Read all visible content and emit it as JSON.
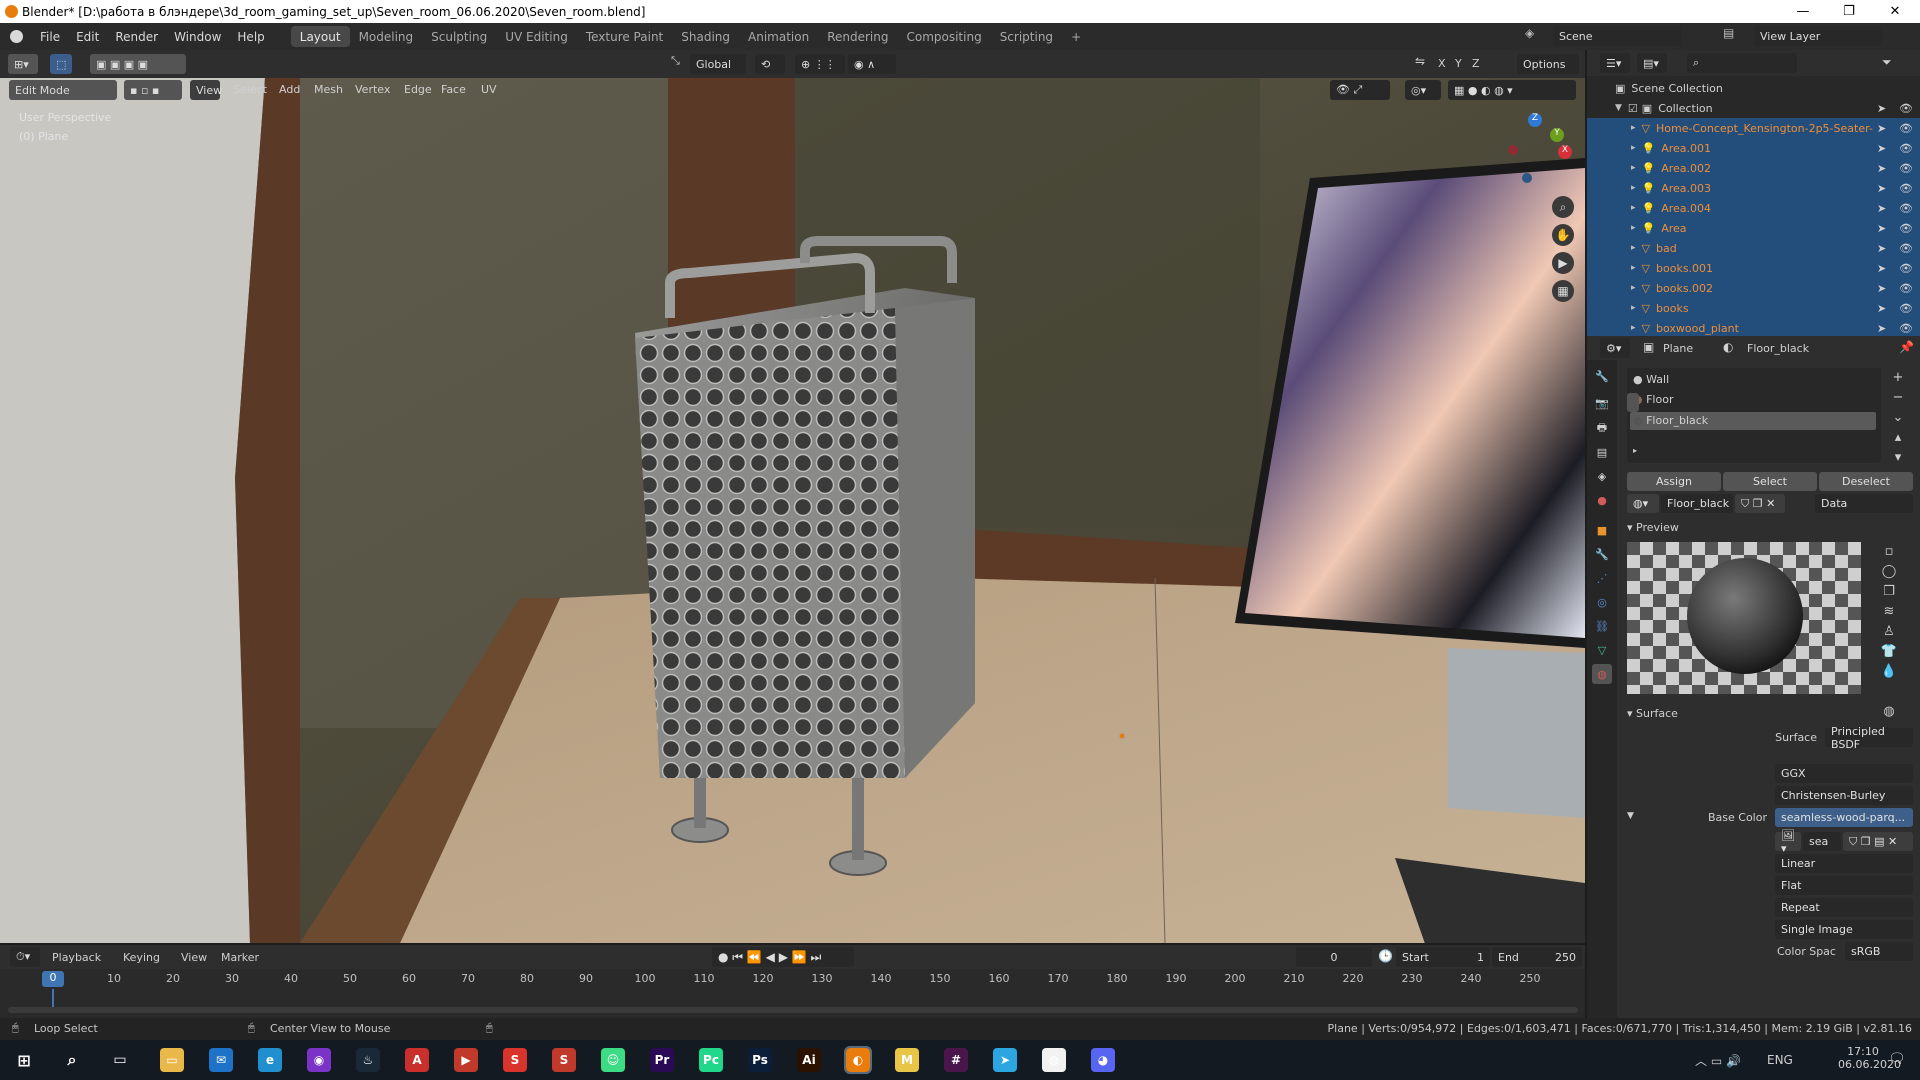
{
  "window": {
    "title": "Blender* [D:\\работа в блэндере\\3d_room_gaming_set_up\\Seven_room_06.06.2020\\Seven_room.blend]",
    "minimize": "—",
    "maximize": "❐",
    "close": "✕"
  },
  "menu": [
    "File",
    "Edit",
    "Render",
    "Window",
    "Help"
  ],
  "workspaces": [
    "Layout",
    "Modeling",
    "Sculpting",
    "UV Editing",
    "Texture Paint",
    "Shading",
    "Animation",
    "Rendering",
    "Compositing",
    "Scripting",
    "+"
  ],
  "scene": {
    "name": "Scene",
    "view_layer": "View Layer"
  },
  "viewport_header": {
    "transform": "Global",
    "options": "Options",
    "axes": [
      "X",
      "Y",
      "Z"
    ]
  },
  "edit_header": {
    "mode": "Edit Mode",
    "items": [
      "View",
      "Select",
      "Add",
      "Mesh",
      "Vertex",
      "Edge",
      "Face",
      "UV"
    ]
  },
  "viewport": {
    "perspective": "User Perspective",
    "object": "(0) Plane",
    "gizmo": {
      "x": "X",
      "y": "Y",
      "z": "Z"
    }
  },
  "outliner": {
    "root": "Scene Collection",
    "collection": "Collection",
    "items": [
      "Home-Concept_Kensington-2p5-Seater-",
      "Area.001",
      "Area.002",
      "Area.003",
      "Area.004",
      "Area",
      "bad",
      "books.001",
      "books.002",
      "books",
      "boxwood_plant"
    ]
  },
  "properties": {
    "object": "Plane",
    "material": "Floor_black",
    "slots": [
      "Wall",
      "Floor",
      "Floor_black"
    ],
    "buttons": {
      "assign": "Assign",
      "select": "Select",
      "deselect": "Deselect"
    },
    "material_field": "Floor_black",
    "link": "Data",
    "preview_label": "Preview",
    "surface_label": "Surface",
    "surface": {
      "label": "Surface",
      "value": "Principled BSDF"
    },
    "distribution": "GGX",
    "subsurface": "Christensen-Burley",
    "base_color": {
      "label": "Base Color",
      "value": "seamless-wood-parq..."
    },
    "image_name": "sea",
    "interpolation": "Linear",
    "projection": "Flat",
    "extension": "Repeat",
    "source": "Single Image",
    "color_space": {
      "label": "Color Spac",
      "value": "sRGB"
    }
  },
  "timeline": {
    "menus": [
      "Playback",
      "Keying",
      "View",
      "Marker"
    ],
    "current_frame": "0",
    "start_label": "Start",
    "start": "1",
    "end_label": "End",
    "end": "250",
    "ticks": [
      "0",
      "10",
      "20",
      "30",
      "40",
      "50",
      "60",
      "70",
      "80",
      "90",
      "100",
      "110",
      "120",
      "130",
      "140",
      "150",
      "160",
      "170",
      "180",
      "190",
      "200",
      "210",
      "220",
      "230",
      "240",
      "250"
    ]
  },
  "status": {
    "left1": "Loop Select",
    "left2": "Center View to Mouse",
    "right": "Plane | Verts:0/954,972 | Edges:0/1,603,471 | Faces:0/671,770 | Tris:1,314,450 | Mem: 2.19 GiB | v2.81.16"
  },
  "taskbar": {
    "lang": "ENG",
    "time": "17:10",
    "date": "06.06.2020",
    "apps": [
      "explorer",
      "mail",
      "edge",
      "podcast",
      "steam",
      "acrobat",
      "red-app",
      "s-app",
      "shield-app",
      "android",
      "premiere",
      "pycharm",
      "photoshop",
      "illustrator",
      "blender",
      "m-app",
      "slack",
      "telegram",
      "chrome",
      "discord"
    ]
  }
}
